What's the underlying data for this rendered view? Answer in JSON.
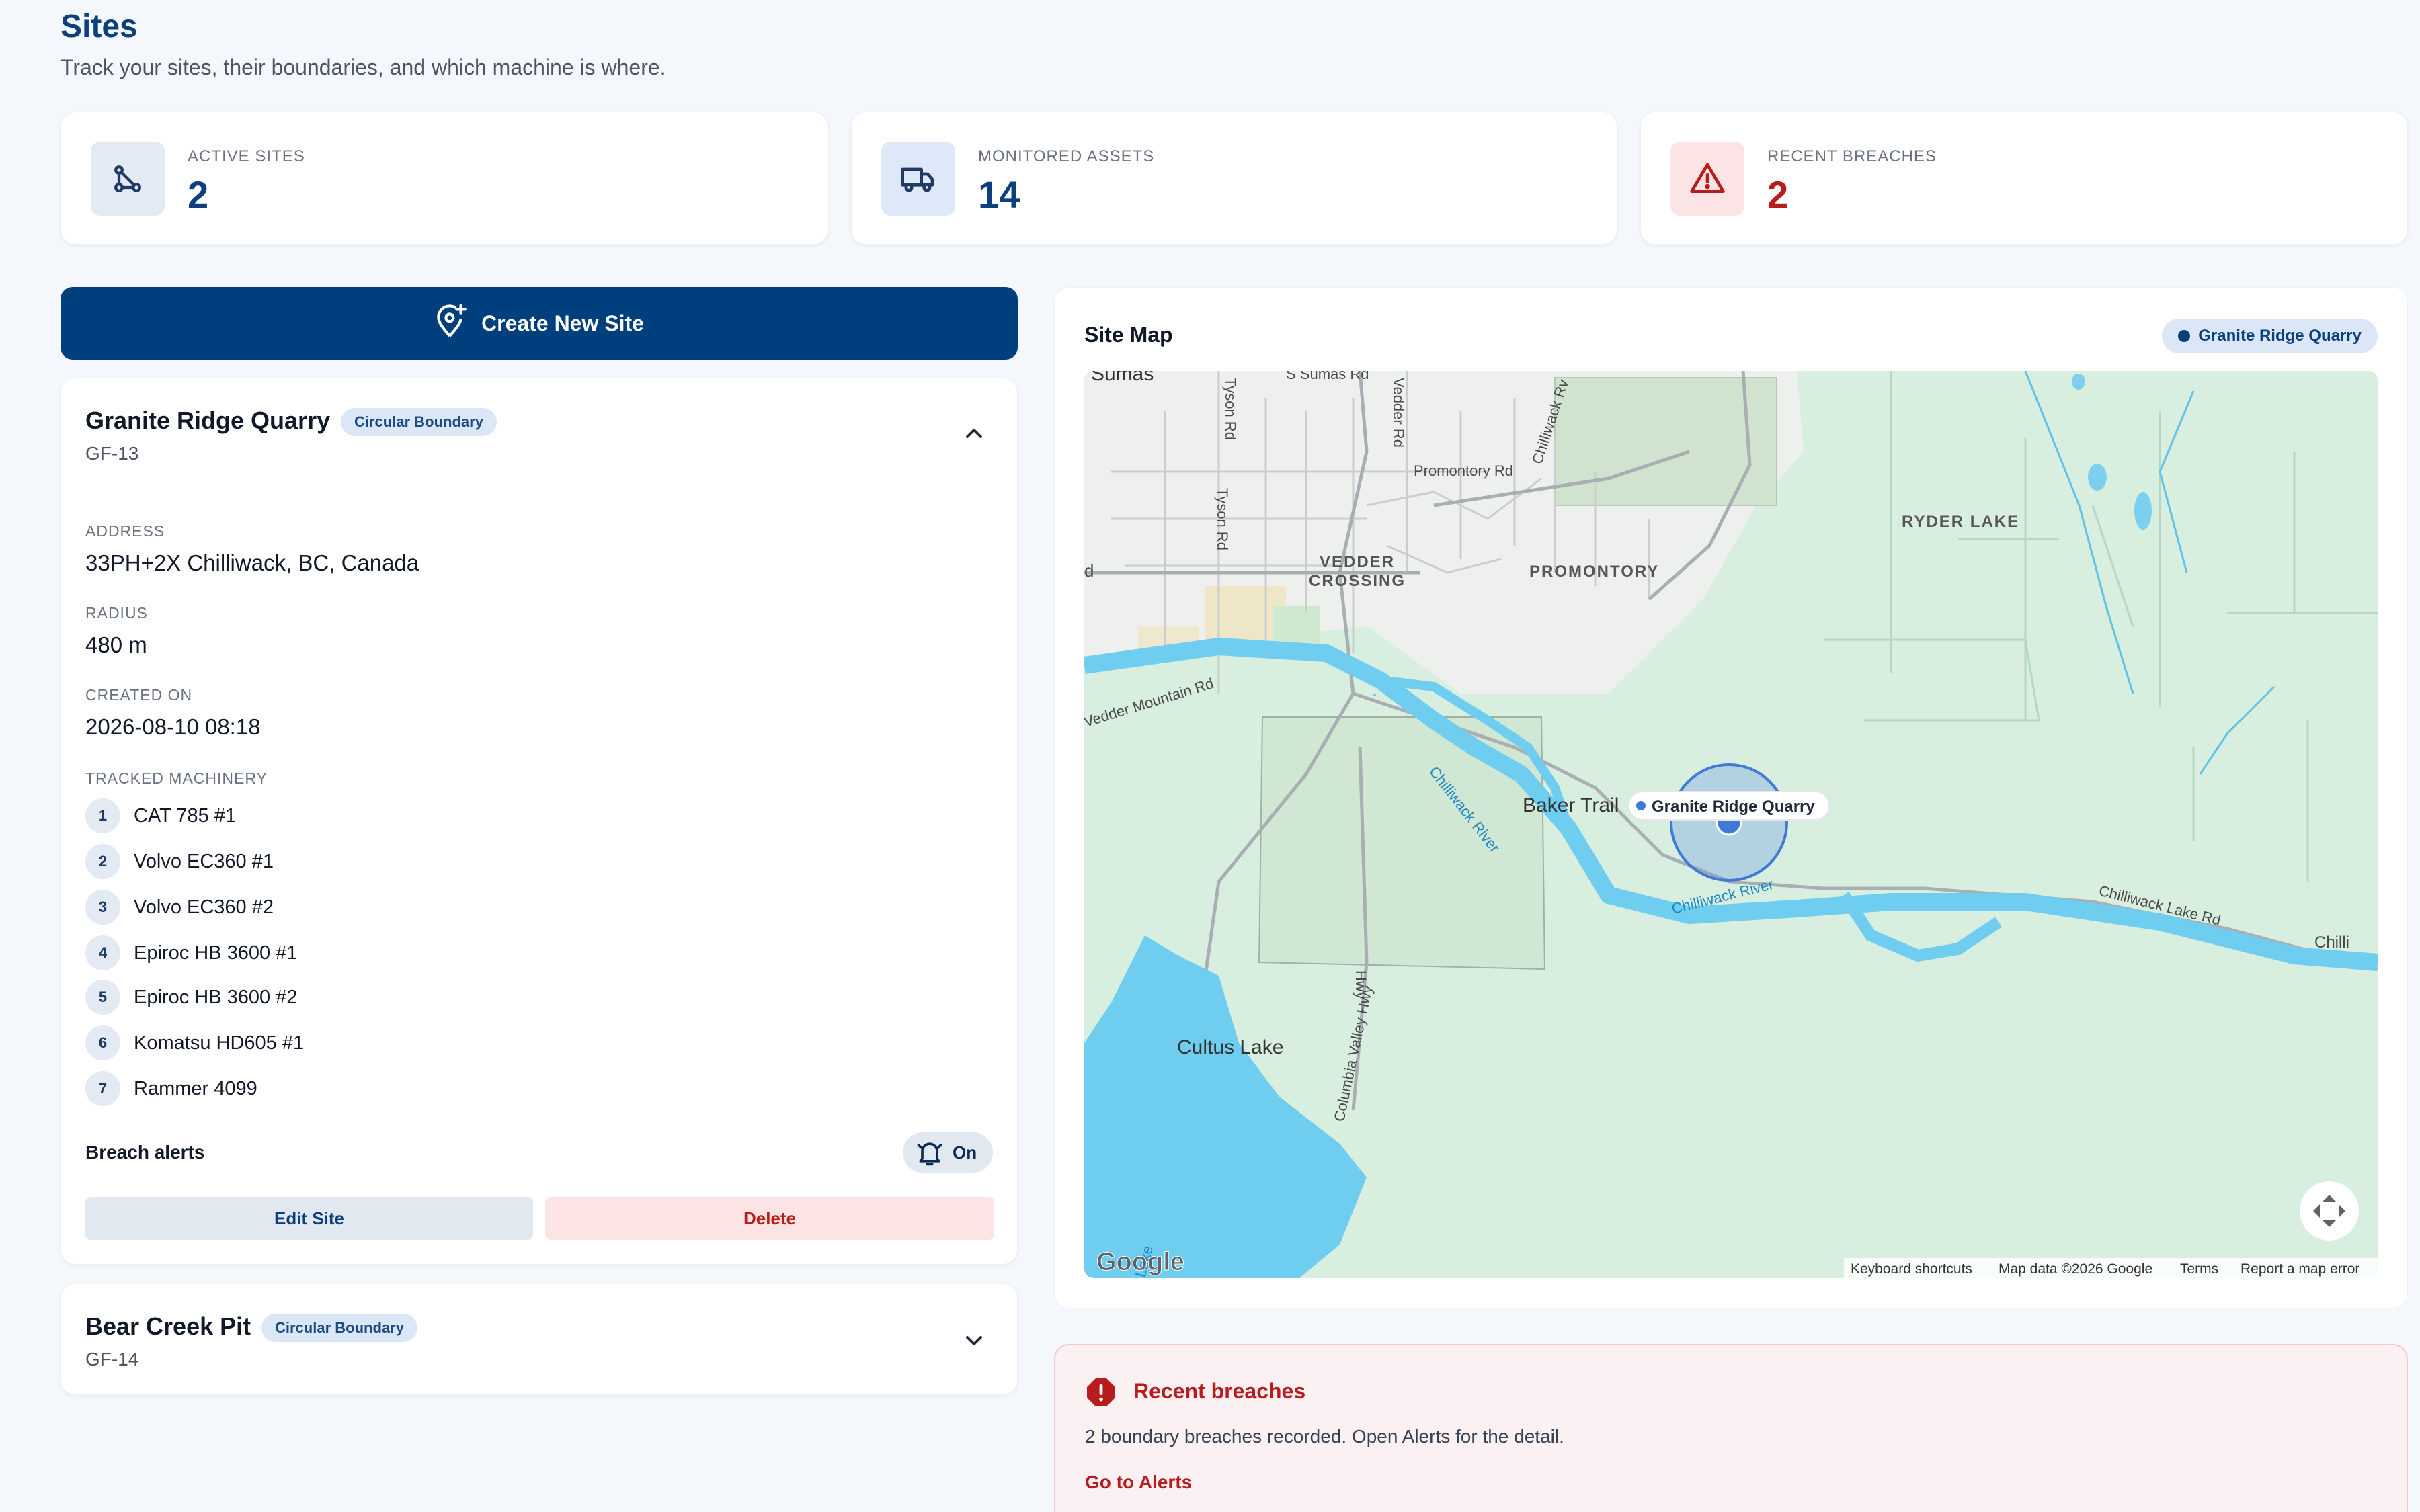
{
  "page": {
    "title": "Sites",
    "subtitle": "Track your sites, their boundaries, and which machine is where."
  },
  "stats": [
    {
      "label": "ACTIVE SITES",
      "value": "2",
      "icon": "share-nodes-icon",
      "accent": "#0b3f7e"
    },
    {
      "label": "MONITORED ASSETS",
      "value": "14",
      "icon": "truck-icon",
      "accent": "#0b3f7e"
    },
    {
      "label": "RECENT BREACHES",
      "value": "2",
      "icon": "warning-triangle-icon",
      "accent": "#b91c1c"
    }
  ],
  "create_button": {
    "label": "Create New Site",
    "icon": "map-pin-plus-icon"
  },
  "sites": [
    {
      "name": "Granite Ridge Quarry",
      "badge": "Circular Boundary",
      "code": "GF-13",
      "expanded": true,
      "fields": {
        "address_label": "ADDRESS",
        "address": "33PH+2X Chilliwack, BC, Canada",
        "radius_label": "RADIUS",
        "radius": "480 m",
        "created_label": "CREATED ON",
        "created": "2026-08-10 08:18",
        "machinery_label": "TRACKED MACHINERY"
      },
      "machinery": [
        {
          "n": "1",
          "name": "CAT 785 #1"
        },
        {
          "n": "2",
          "name": "Volvo EC360 #1"
        },
        {
          "n": "3",
          "name": "Volvo EC360 #2"
        },
        {
          "n": "4",
          "name": "Epiroc HB 3600 #1"
        },
        {
          "n": "5",
          "name": "Epiroc HB 3600 #2"
        },
        {
          "n": "6",
          "name": "Komatsu HD605 #1"
        },
        {
          "n": "7",
          "name": "Rammer 4099"
        }
      ],
      "breach_alerts_label": "Breach alerts",
      "breach_alerts_state": "On",
      "edit_label": "Edit Site",
      "delete_label": "Delete"
    },
    {
      "name": "Bear Creek Pit",
      "badge": "Circular Boundary",
      "code": "GF-14",
      "expanded": false
    }
  ],
  "map": {
    "title": "Site Map",
    "chip": "Granite Ridge Quarry",
    "labels": {
      "sumas": "Sumas",
      "s_sumas_rd": "S Sumas Rd",
      "tyson_rd_top": "Tyson Rd",
      "tyson_rd": "Tyson Rd",
      "vedder_rd": "Vedder Rd",
      "chilliwack_rv": "Chilliwack Rv",
      "promontory_rd": "Promontory Rd",
      "ryder_lake": "RYDER LAKE",
      "vedder_crossing_1": "VEDDER",
      "vedder_crossing_2": "CROSSING",
      "promontory": "PROMONTORY",
      "d": "d",
      "vedder_mountain_rd": "Vedder Mountain Rd",
      "chilliwack_river_1": "Chilliwack River",
      "chilliwack_river_2": "Chilliwack River",
      "baker_trail": "Baker Trail",
      "marker_label": "Granite Ridge Quarry",
      "chilliwack_lake_rd": "Chilliwack Lake Rd",
      "chilli": "Chilli",
      "cultus_lake": "Cultus Lake",
      "hwy_1": "Hwy",
      "columbia_valley_hwy": "Columbia Valley Hwy",
      "lake_edge": "Lake",
      "google": "Google"
    },
    "footer": {
      "shortcuts": "Keyboard shortcuts",
      "data": "Map data ©2026 Google",
      "terms": "Terms",
      "report": "Report a map error"
    }
  },
  "breaches": {
    "title": "Recent breaches",
    "text": "2 boundary breaches recorded. Open Alerts for the detail.",
    "link": "Go to Alerts"
  }
}
